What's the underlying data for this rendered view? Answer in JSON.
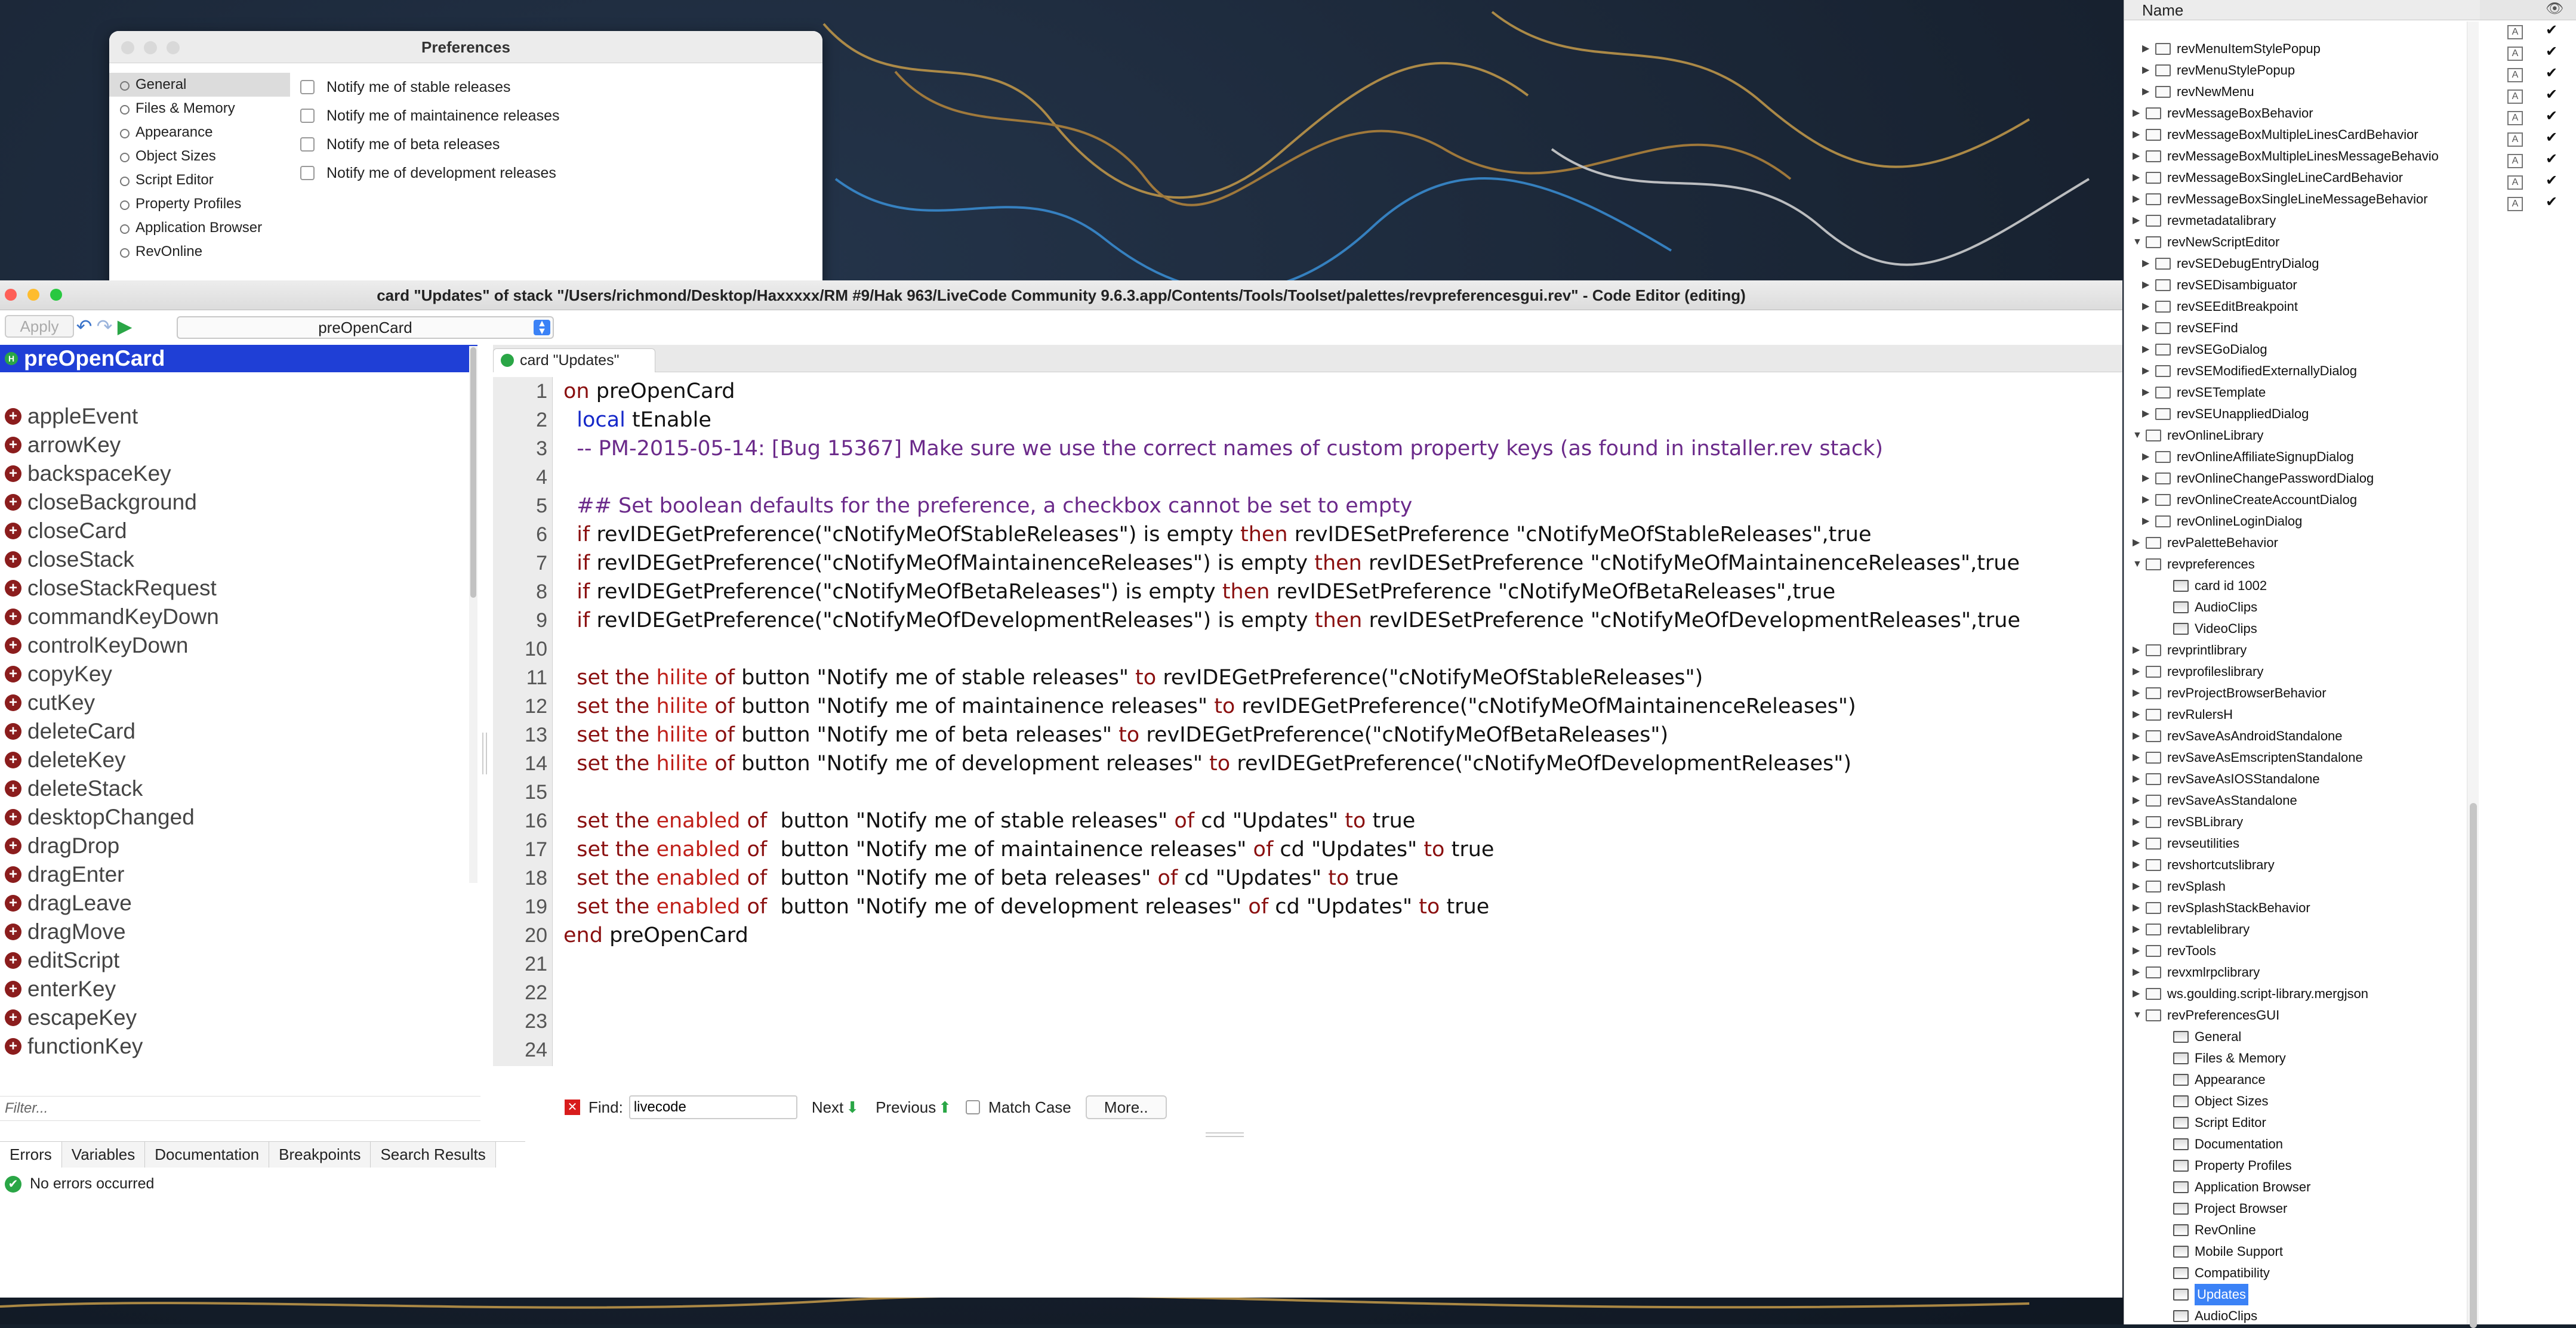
{
  "prefs": {
    "title": "Preferences",
    "sections": [
      "General",
      "Files & Memory",
      "Appearance",
      "Object Sizes",
      "Script Editor",
      "Property Profiles",
      "Application Browser",
      "RevOnline"
    ],
    "options": [
      "Notify me of stable releases",
      "Notify me of maintainence releases",
      "Notify me of beta releases",
      "Notify me of development releases"
    ]
  },
  "editor": {
    "title": "card \"Updates\" of stack \"/Users/richmond/Desktop/Haxxxxx/RM #9/Hak 963/LiveCode Community 9.6.3.app/Contents/Tools/Toolset/palettes/revpreferencesgui.rev\" - Code Editor (editing)",
    "apply_label": "Apply",
    "handler_select": "preOpenCard",
    "current_handler": "preOpenCard",
    "handlers": [
      "appleEvent",
      "arrowKey",
      "backspaceKey",
      "closeBackground",
      "closeCard",
      "closeStack",
      "closeStackRequest",
      "commandKeyDown",
      "controlKeyDown",
      "copyKey",
      "cutKey",
      "deleteCard",
      "deleteKey",
      "deleteStack",
      "desktopChanged",
      "dragDrop",
      "dragEnter",
      "dragLeave",
      "dragMove",
      "editScript",
      "enterKey",
      "escapeKey",
      "functionKey"
    ],
    "filter_placeholder": "Filter...",
    "tab_label": "card \"Updates\"",
    "line_numbers": [
      "1",
      "2",
      "3",
      "4",
      "5",
      "6",
      "7",
      "8",
      "9",
      "10",
      "11",
      "12",
      "13",
      "14",
      "15",
      "16",
      "17",
      "18",
      "19",
      "20",
      "21",
      "22",
      "23",
      "24"
    ],
    "code": [
      [
        [
          "kw",
          "on "
        ],
        [
          "",
          "preOpenCard"
        ]
      ],
      [
        [
          "lc",
          "  local "
        ],
        [
          "",
          "tEnable"
        ]
      ],
      [
        [
          "cm",
          "  -- PM-2015-05-14: [Bug 15367] Make sure we use the correct names of custom property keys (as found in installer.rev stack)"
        ]
      ],
      [],
      [
        [
          "cm",
          "  ## Set boolean defaults for the preference, a checkbox cannot be set to empty"
        ]
      ],
      [
        [
          "kw",
          "  if "
        ],
        [
          "",
          "revIDEGetPreference(\"cNotifyMeOfStableReleases\") is empty "
        ],
        [
          "kw",
          "then "
        ],
        [
          "",
          "revIDESetPreference \"cNotifyMeOfStableReleases\",true"
        ]
      ],
      [
        [
          "kw",
          "  if "
        ],
        [
          "",
          "revIDEGetPreference(\"cNotifyMeOfMaintainenceReleases\") is empty "
        ],
        [
          "kw",
          "then "
        ],
        [
          "",
          "revIDESetPreference \"cNotifyMeOfMaintainenceReleases\",true"
        ]
      ],
      [
        [
          "kw",
          "  if "
        ],
        [
          "",
          "revIDEGetPreference(\"cNotifyMeOfBetaReleases\") is empty "
        ],
        [
          "kw",
          "then "
        ],
        [
          "",
          "revIDESetPreference \"cNotifyMeOfBetaReleases\",true"
        ]
      ],
      [
        [
          "kw",
          "  if "
        ],
        [
          "",
          "revIDEGetPreference(\"cNotifyMeOfDevelopmentReleases\") is empty "
        ],
        [
          "kw",
          "then "
        ],
        [
          "",
          "revIDESetPreference \"cNotifyMeOfDevelopmentReleases\",true"
        ]
      ],
      [],
      [
        [
          "kw",
          "  set "
        ],
        [
          "kw",
          "the "
        ],
        [
          "red",
          "hilite "
        ],
        [
          "kw",
          "of "
        ],
        [
          "",
          "button \"Notify me of stable releases\" "
        ],
        [
          "kw",
          "to "
        ],
        [
          "",
          "revIDEGetPreference(\"cNotifyMeOfStableReleases\")"
        ]
      ],
      [
        [
          "kw",
          "  set "
        ],
        [
          "kw",
          "the "
        ],
        [
          "red",
          "hilite "
        ],
        [
          "kw",
          "of "
        ],
        [
          "",
          "button \"Notify me of maintainence releases\" "
        ],
        [
          "kw",
          "to "
        ],
        [
          "",
          "revIDEGetPreference(\"cNotifyMeOfMaintainenceReleases\")"
        ]
      ],
      [
        [
          "kw",
          "  set "
        ],
        [
          "kw",
          "the "
        ],
        [
          "red",
          "hilite "
        ],
        [
          "kw",
          "of "
        ],
        [
          "",
          "button \"Notify me of beta releases\" "
        ],
        [
          "kw",
          "to "
        ],
        [
          "",
          "revIDEGetPreference(\"cNotifyMeOfBetaReleases\")"
        ]
      ],
      [
        [
          "kw",
          "  set "
        ],
        [
          "kw",
          "the "
        ],
        [
          "red",
          "hilite "
        ],
        [
          "kw",
          "of "
        ],
        [
          "",
          "button \"Notify me of development releases\" "
        ],
        [
          "kw",
          "to "
        ],
        [
          "",
          "revIDEGetPreference(\"cNotifyMeOfDevelopmentReleases\")"
        ]
      ],
      [],
      [
        [
          "kw",
          "  set "
        ],
        [
          "kw",
          "the "
        ],
        [
          "red",
          "enabled "
        ],
        [
          "kw",
          "of  "
        ],
        [
          "",
          "button \"Notify me of stable releases\" "
        ],
        [
          "kw",
          "of "
        ],
        [
          "",
          "cd \"Updates\" "
        ],
        [
          "kw",
          "to "
        ],
        [
          "",
          "true"
        ]
      ],
      [
        [
          "kw",
          "  set "
        ],
        [
          "kw",
          "the "
        ],
        [
          "red",
          "enabled "
        ],
        [
          "kw",
          "of  "
        ],
        [
          "",
          "button \"Notify me of maintainence releases\" "
        ],
        [
          "kw",
          "of "
        ],
        [
          "",
          "cd \"Updates\" "
        ],
        [
          "kw",
          "to "
        ],
        [
          "",
          "true"
        ]
      ],
      [
        [
          "kw",
          "  set "
        ],
        [
          "kw",
          "the "
        ],
        [
          "red",
          "enabled "
        ],
        [
          "kw",
          "of  "
        ],
        [
          "",
          "button \"Notify me of beta releases\" "
        ],
        [
          "kw",
          "of "
        ],
        [
          "",
          "cd \"Updates\" "
        ],
        [
          "kw",
          "to "
        ],
        [
          "",
          "true"
        ]
      ],
      [
        [
          "kw",
          "  set "
        ],
        [
          "kw",
          "the "
        ],
        [
          "red",
          "enabled "
        ],
        [
          "kw",
          "of  "
        ],
        [
          "",
          "button \"Notify me of development releases\" "
        ],
        [
          "kw",
          "of "
        ],
        [
          "",
          "cd \"Updates\" "
        ],
        [
          "kw",
          "to "
        ],
        [
          "",
          "true"
        ]
      ],
      [
        [
          "kw",
          "end "
        ],
        [
          "",
          "preOpenCard"
        ]
      ],
      [],
      [],
      [],
      []
    ],
    "find": {
      "label": "Find:",
      "value": "livecode",
      "next": "Next",
      "previous": "Previous",
      "match_case": "Match Case",
      "more": "More.."
    },
    "bottom_tabs": [
      "Errors",
      "Variables",
      "Documentation",
      "Breakpoints",
      "Search Results"
    ],
    "status": "No errors occurred"
  },
  "project_browser": {
    "column_name": "Name",
    "rows": [
      {
        "indent": 1,
        "tri": "▶",
        "icon": "stack",
        "label": "revMenuItemStylePopup"
      },
      {
        "indent": 1,
        "tri": "▶",
        "icon": "stack",
        "label": "revMenuStylePopup"
      },
      {
        "indent": 1,
        "tri": "▶",
        "icon": "stack",
        "label": "revNewMenu"
      },
      {
        "indent": 0,
        "tri": "▶",
        "icon": "stack",
        "label": "revMessageBoxBehavior"
      },
      {
        "indent": 0,
        "tri": "▶",
        "icon": "stack",
        "label": "revMessageBoxMultipleLinesCardBehavior"
      },
      {
        "indent": 0,
        "tri": "▶",
        "icon": "stack",
        "label": "revMessageBoxMultipleLinesMessageBehavio"
      },
      {
        "indent": 0,
        "tri": "▶",
        "icon": "stack",
        "label": "revMessageBoxSingleLineCardBehavior"
      },
      {
        "indent": 0,
        "tri": "▶",
        "icon": "stack",
        "label": "revMessageBoxSingleLineMessageBehavior"
      },
      {
        "indent": 0,
        "tri": "▶",
        "icon": "stack",
        "label": "revmetadatalibrary"
      },
      {
        "indent": 0,
        "tri": "▼",
        "icon": "stack",
        "label": "revNewScriptEditor"
      },
      {
        "indent": 1,
        "tri": "▶",
        "icon": "stack",
        "label": "revSEDebugEntryDialog"
      },
      {
        "indent": 1,
        "tri": "▶",
        "icon": "stack",
        "label": "revSEDisambiguator"
      },
      {
        "indent": 1,
        "tri": "▶",
        "icon": "stack",
        "label": "revSEEditBreakpoint"
      },
      {
        "indent": 1,
        "tri": "▶",
        "icon": "stack",
        "label": "revSEFind"
      },
      {
        "indent": 1,
        "tri": "▶",
        "icon": "stack",
        "label": "revSEGoDialog"
      },
      {
        "indent": 1,
        "tri": "▶",
        "icon": "stack",
        "label": "revSEModifiedExternallyDialog"
      },
      {
        "indent": 1,
        "tri": "▶",
        "icon": "stack",
        "label": "revSETemplate"
      },
      {
        "indent": 1,
        "tri": "▶",
        "icon": "stack",
        "label": "revSEUnappliedDialog"
      },
      {
        "indent": 0,
        "tri": "▼",
        "icon": "stack",
        "label": "revOnlineLibrary"
      },
      {
        "indent": 1,
        "tri": "▶",
        "icon": "stack",
        "label": "revOnlineAffiliateSignupDialog"
      },
      {
        "indent": 1,
        "tri": "▶",
        "icon": "stack",
        "label": "revOnlineChangePasswordDialog"
      },
      {
        "indent": 1,
        "tri": "▶",
        "icon": "stack",
        "label": "revOnlineCreateAccountDialog"
      },
      {
        "indent": 1,
        "tri": "▶",
        "icon": "stack",
        "label": "revOnlineLoginDialog"
      },
      {
        "indent": 0,
        "tri": "▶",
        "icon": "stack",
        "label": "revPaletteBehavior"
      },
      {
        "indent": 0,
        "tri": "▼",
        "icon": "stack",
        "label": "revpreferences"
      },
      {
        "indent": 1,
        "tri": "",
        "icon": "card",
        "label": "card id 1002"
      },
      {
        "indent": 1,
        "tri": "",
        "icon": "card",
        "label": "AudioClips"
      },
      {
        "indent": 1,
        "tri": "",
        "icon": "card",
        "label": "VideoClips"
      },
      {
        "indent": 0,
        "tri": "▶",
        "icon": "stack",
        "label": "revprintlibrary"
      },
      {
        "indent": 0,
        "tri": "▶",
        "icon": "stack",
        "label": "revprofileslibrary"
      },
      {
        "indent": 0,
        "tri": "▶",
        "icon": "stack",
        "label": "revProjectBrowserBehavior"
      },
      {
        "indent": 0,
        "tri": "▶",
        "icon": "stack",
        "label": "revRulersH"
      },
      {
        "indent": 0,
        "tri": "▶",
        "icon": "stack",
        "label": "revSaveAsAndroidStandalone"
      },
      {
        "indent": 0,
        "tri": "▶",
        "icon": "stack",
        "label": "revSaveAsEmscriptenStandalone"
      },
      {
        "indent": 0,
        "tri": "▶",
        "icon": "stack",
        "label": "revSaveAsIOSStandalone"
      },
      {
        "indent": 0,
        "tri": "▶",
        "icon": "stack",
        "label": "revSaveAsStandalone"
      },
      {
        "indent": 0,
        "tri": "▶",
        "icon": "stack",
        "label": "revSBLibrary"
      },
      {
        "indent": 0,
        "tri": "▶",
        "icon": "stack",
        "label": "revseutilities"
      },
      {
        "indent": 0,
        "tri": "▶",
        "icon": "stack",
        "label": "revshortcutslibrary"
      },
      {
        "indent": 0,
        "tri": "▶",
        "icon": "stack",
        "label": "revSplash"
      },
      {
        "indent": 0,
        "tri": "▶",
        "icon": "stack",
        "label": "revSplashStackBehavior"
      },
      {
        "indent": 0,
        "tri": "▶",
        "icon": "stack",
        "label": "revtablelibrary"
      },
      {
        "indent": 0,
        "tri": "▶",
        "icon": "stack",
        "label": "revTools"
      },
      {
        "indent": 0,
        "tri": "▶",
        "icon": "stack",
        "label": "revxmlrpclibrary"
      },
      {
        "indent": 0,
        "tri": "▶",
        "icon": "stack",
        "label": "ws.goulding.script-library.mergjson"
      },
      {
        "indent": 0,
        "tri": "▼",
        "icon": "stack",
        "label": "revPreferencesGUI"
      },
      {
        "indent": 1,
        "tri": "",
        "icon": "card",
        "label": "General"
      },
      {
        "indent": 1,
        "tri": "",
        "icon": "card",
        "label": "Files & Memory"
      },
      {
        "indent": 1,
        "tri": "",
        "icon": "card",
        "label": "Appearance"
      },
      {
        "indent": 1,
        "tri": "",
        "icon": "card",
        "label": "Object Sizes"
      },
      {
        "indent": 1,
        "tri": "",
        "icon": "card",
        "label": "Script Editor"
      },
      {
        "indent": 1,
        "tri": "",
        "icon": "card",
        "label": "Documentation"
      },
      {
        "indent": 1,
        "tri": "",
        "icon": "card",
        "label": "Property Profiles"
      },
      {
        "indent": 1,
        "tri": "",
        "icon": "card",
        "label": "Application Browser"
      },
      {
        "indent": 1,
        "tri": "",
        "icon": "card",
        "label": "Project Browser"
      },
      {
        "indent": 1,
        "tri": "",
        "icon": "card",
        "label": "RevOnline"
      },
      {
        "indent": 1,
        "tri": "",
        "icon": "card",
        "label": "Mobile Support"
      },
      {
        "indent": 1,
        "tri": "",
        "icon": "card",
        "label": "Compatibility"
      },
      {
        "indent": 1,
        "tri": "",
        "icon": "card",
        "label": "Updates",
        "selected": true
      },
      {
        "indent": 1,
        "tri": "",
        "icon": "card",
        "label": "AudioClips"
      }
    ],
    "column_icons": [
      "A",
      "A",
      "A",
      "A",
      "A",
      "A",
      "A",
      "A",
      "A"
    ],
    "checks": [
      "✔",
      "✔",
      "✔",
      "✔",
      "✔",
      "✔",
      "✔",
      "✔",
      "✔"
    ]
  }
}
